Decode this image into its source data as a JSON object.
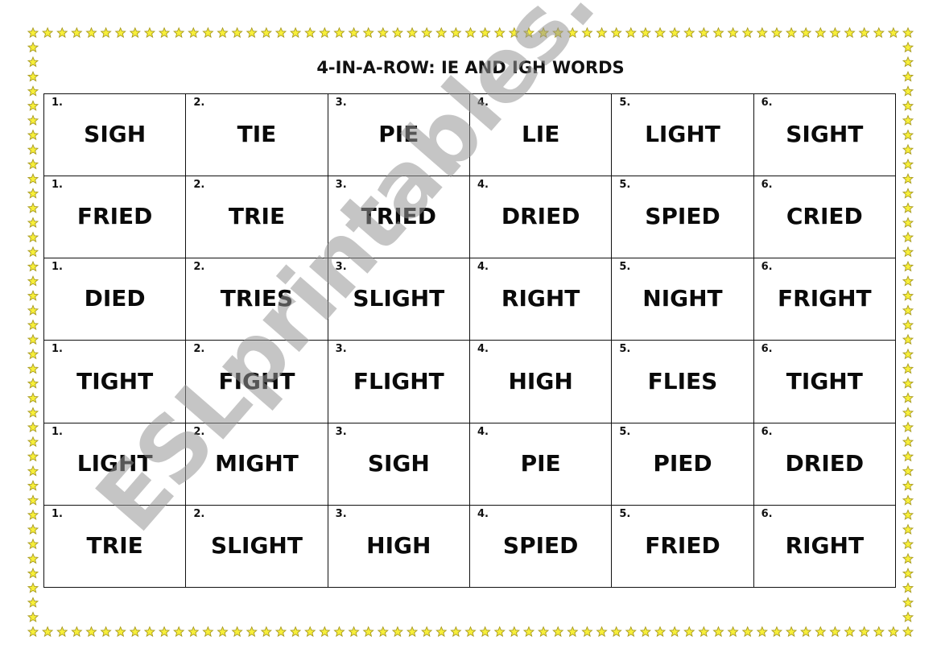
{
  "title": "4-IN-A-ROW: IE AND IGH WORDS",
  "watermark": "ESLprintables.com",
  "colors": {
    "star_fill": "#f7ef3a",
    "star_stroke": "#a89a20",
    "grid_line": "#111111",
    "watermark": "#969696"
  },
  "border_icon": "star-icon",
  "grid": [
    [
      {
        "num": "1.",
        "word": "SIGH"
      },
      {
        "num": "2.",
        "word": "TIE"
      },
      {
        "num": "3.",
        "word": "PIE"
      },
      {
        "num": "4.",
        "word": "LIE"
      },
      {
        "num": "5.",
        "word": "LIGHT"
      },
      {
        "num": "6.",
        "word": "SIGHT"
      }
    ],
    [
      {
        "num": "1.",
        "word": "FRIED"
      },
      {
        "num": "2.",
        "word": "TRIE"
      },
      {
        "num": "3.",
        "word": "TRIED"
      },
      {
        "num": "4.",
        "word": "DRIED"
      },
      {
        "num": "5.",
        "word": "SPIED"
      },
      {
        "num": "6.",
        "word": "CRIED"
      }
    ],
    [
      {
        "num": "1.",
        "word": "DIED"
      },
      {
        "num": "2.",
        "word": "TRIES"
      },
      {
        "num": "3.",
        "word": "SLIGHT"
      },
      {
        "num": "4.",
        "word": "RIGHT"
      },
      {
        "num": "5.",
        "word": "NIGHT"
      },
      {
        "num": "6.",
        "word": "FRIGHT"
      }
    ],
    [
      {
        "num": "1.",
        "word": "TIGHT"
      },
      {
        "num": "2.",
        "word": "FIGHT"
      },
      {
        "num": "3.",
        "word": "FLIGHT"
      },
      {
        "num": "4.",
        "word": "HIGH"
      },
      {
        "num": "5.",
        "word": "FLIES"
      },
      {
        "num": "6.",
        "word": "TIGHT"
      }
    ],
    [
      {
        "num": "1.",
        "word": "LIGHT"
      },
      {
        "num": "2.",
        "word": "MIGHT"
      },
      {
        "num": "3.",
        "word": "SIGH"
      },
      {
        "num": "4.",
        "word": "PIE"
      },
      {
        "num": "5.",
        "word": "PIED"
      },
      {
        "num": "6.",
        "word": "DRIED"
      }
    ],
    [
      {
        "num": "1.",
        "word": "TRIE"
      },
      {
        "num": "2.",
        "word": "SLIGHT"
      },
      {
        "num": "3.",
        "word": "HIGH"
      },
      {
        "num": "4.",
        "word": "SPIED"
      },
      {
        "num": "5.",
        "word": "FRIED"
      },
      {
        "num": "6.",
        "word": "RIGHT"
      }
    ]
  ]
}
